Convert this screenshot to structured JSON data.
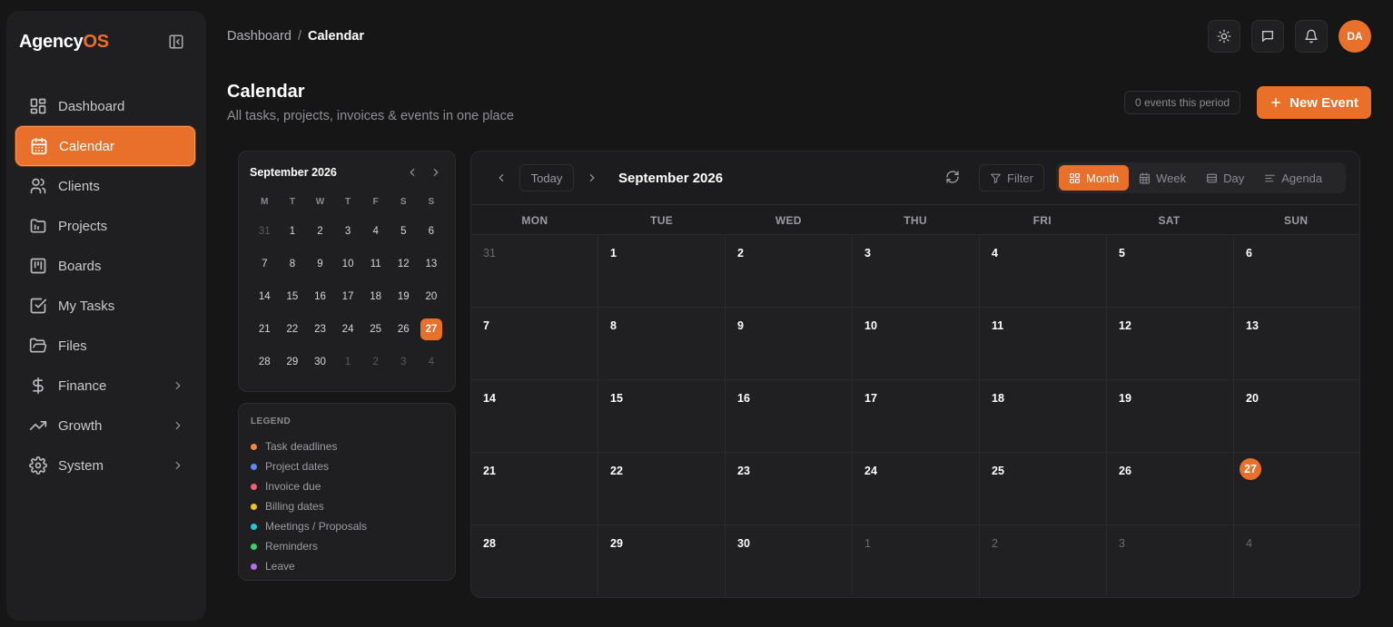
{
  "app": {
    "logo_main": "Agency",
    "logo_accent": "OS"
  },
  "sidebar": {
    "items": [
      {
        "label": "Dashboard",
        "icon": "dashboard-icon"
      },
      {
        "label": "Calendar",
        "icon": "calendar-icon",
        "active": true
      },
      {
        "label": "Clients",
        "icon": "users-icon"
      },
      {
        "label": "Projects",
        "icon": "folder-icon"
      },
      {
        "label": "Boards",
        "icon": "kanban-icon"
      },
      {
        "label": "My Tasks",
        "icon": "checkbox-icon"
      },
      {
        "label": "Files",
        "icon": "folder-open-icon"
      },
      {
        "label": "Finance",
        "icon": "dollar-icon",
        "has_submenu": true
      },
      {
        "label": "Growth",
        "icon": "trending-up-icon",
        "has_submenu": true
      },
      {
        "label": "System",
        "icon": "gear-icon",
        "has_submenu": true
      }
    ]
  },
  "breadcrumb": {
    "parent": "Dashboard",
    "separator": "/",
    "current": "Calendar"
  },
  "user": {
    "initials": "DA"
  },
  "page": {
    "title": "Calendar",
    "subtitle": "All tasks, projects, invoices & events in one place",
    "events_count": "0 events this period",
    "new_event_label": "New Event"
  },
  "mini_calendar": {
    "title": "September 2026",
    "weekdays": [
      "M",
      "T",
      "W",
      "T",
      "F",
      "S",
      "S"
    ],
    "days": [
      {
        "d": "31",
        "muted": true
      },
      {
        "d": "1"
      },
      {
        "d": "2"
      },
      {
        "d": "3"
      },
      {
        "d": "4"
      },
      {
        "d": "5"
      },
      {
        "d": "6"
      },
      {
        "d": "7"
      },
      {
        "d": "8"
      },
      {
        "d": "9"
      },
      {
        "d": "10"
      },
      {
        "d": "11"
      },
      {
        "d": "12"
      },
      {
        "d": "13"
      },
      {
        "d": "14"
      },
      {
        "d": "15"
      },
      {
        "d": "16"
      },
      {
        "d": "17"
      },
      {
        "d": "18"
      },
      {
        "d": "19"
      },
      {
        "d": "20"
      },
      {
        "d": "21"
      },
      {
        "d": "22"
      },
      {
        "d": "23"
      },
      {
        "d": "24"
      },
      {
        "d": "25"
      },
      {
        "d": "26"
      },
      {
        "d": "27",
        "today": true
      },
      {
        "d": "28"
      },
      {
        "d": "29"
      },
      {
        "d": "30"
      },
      {
        "d": "1",
        "muted": true
      },
      {
        "d": "2",
        "muted": true
      },
      {
        "d": "3",
        "muted": true
      },
      {
        "d": "4",
        "muted": true
      }
    ]
  },
  "legend": {
    "title": "LEGEND",
    "items": [
      {
        "label": "Task deadlines",
        "color": "#f0883e"
      },
      {
        "label": "Project dates",
        "color": "#5b8def"
      },
      {
        "label": "Invoice due",
        "color": "#f06272"
      },
      {
        "label": "Billing dates",
        "color": "#f2bf2b"
      },
      {
        "label": "Meetings / Proposals",
        "color": "#22c7d6"
      },
      {
        "label": "Reminders",
        "color": "#3fcf6e"
      },
      {
        "label": "Leave",
        "color": "#b46cf0"
      }
    ]
  },
  "calendar": {
    "today_label": "Today",
    "title": "September 2026",
    "filter_label": "Filter",
    "views": [
      {
        "label": "Month",
        "icon": "grid-icon",
        "active": true
      },
      {
        "label": "Week",
        "icon": "calendar-week-icon"
      },
      {
        "label": "Day",
        "icon": "calendar-day-icon"
      },
      {
        "label": "Agenda",
        "icon": "list-icon"
      }
    ],
    "weekdays": [
      "MON",
      "TUE",
      "WED",
      "THU",
      "FRI",
      "SAT",
      "SUN"
    ],
    "days": [
      {
        "d": "31",
        "muted": true
      },
      {
        "d": "1"
      },
      {
        "d": "2"
      },
      {
        "d": "3"
      },
      {
        "d": "4"
      },
      {
        "d": "5"
      },
      {
        "d": "6"
      },
      {
        "d": "7"
      },
      {
        "d": "8"
      },
      {
        "d": "9"
      },
      {
        "d": "10"
      },
      {
        "d": "11"
      },
      {
        "d": "12"
      },
      {
        "d": "13"
      },
      {
        "d": "14"
      },
      {
        "d": "15"
      },
      {
        "d": "16"
      },
      {
        "d": "17"
      },
      {
        "d": "18"
      },
      {
        "d": "19"
      },
      {
        "d": "20"
      },
      {
        "d": "21"
      },
      {
        "d": "22"
      },
      {
        "d": "23"
      },
      {
        "d": "24"
      },
      {
        "d": "25"
      },
      {
        "d": "26"
      },
      {
        "d": "27",
        "today": true
      },
      {
        "d": "28"
      },
      {
        "d": "29"
      },
      {
        "d": "30"
      },
      {
        "d": "1",
        "muted": true
      },
      {
        "d": "2",
        "muted": true
      },
      {
        "d": "3",
        "muted": true
      },
      {
        "d": "4",
        "muted": true
      }
    ]
  },
  "colors": {
    "accent": "#e8702a",
    "background": "#161617",
    "panel": "#1f1f21"
  }
}
